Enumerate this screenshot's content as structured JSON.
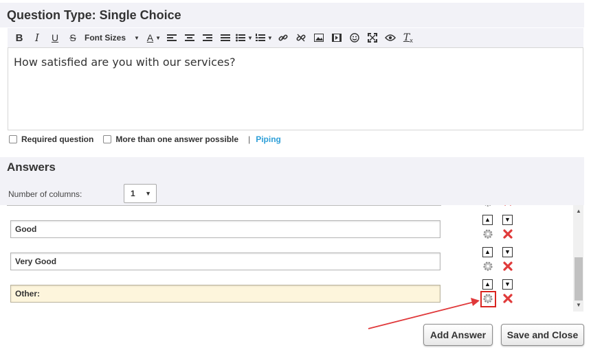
{
  "question": {
    "title": "Question Type: Single Choice",
    "text": "How satisfied are you with our services?"
  },
  "toolbar": {
    "font_sizes_label": "Font Sizes",
    "icons": [
      "bold-icon",
      "italic-icon",
      "underline-icon",
      "strikethrough-icon",
      "font-color-icon",
      "align-left-icon",
      "align-center-icon",
      "align-right-icon",
      "align-justify-icon",
      "bullet-list-icon",
      "numbered-list-icon",
      "link-icon",
      "unlink-icon",
      "image-icon",
      "video-icon",
      "emoji-icon",
      "fullscreen-icon",
      "preview-icon",
      "clear-format-icon"
    ]
  },
  "options": {
    "required_label": "Required question",
    "multi_label": "More than one answer possible",
    "separator": "|",
    "piping_label": "Piping"
  },
  "answers": {
    "title": "Answers",
    "columns_label": "Number of columns:",
    "columns_value": "1",
    "items": [
      {
        "text": "Good"
      },
      {
        "text": "Very Good"
      },
      {
        "text": "Other:"
      }
    ]
  },
  "buttons": {
    "add_answer": "Add Answer",
    "save_close": "Save and Close"
  },
  "colors": {
    "panel_bg": "#f2f2f7",
    "link": "#2e9fd8",
    "highlight": "#d9241f",
    "other_bg": "#fdf5dc"
  }
}
